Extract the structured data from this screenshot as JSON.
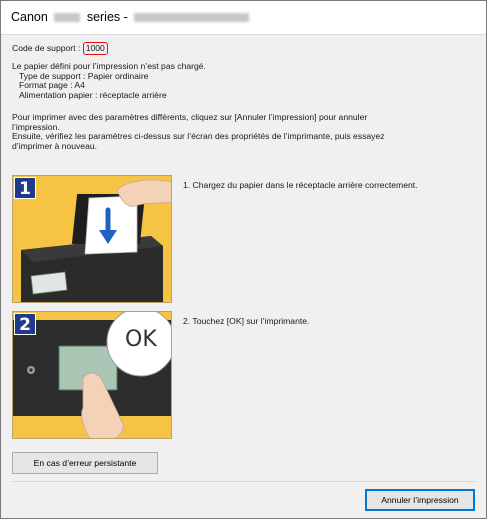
{
  "window": {
    "title_prefix": "Canon",
    "title_suffix": "series -"
  },
  "error": {
    "code_label": "Code de support :",
    "code_value": "1000"
  },
  "message": {
    "line1": "Le papier défini pour l’impression n’est pas chargé.",
    "media_type": "Type de support : Papier ordinaire",
    "page_size": "Format page : A4",
    "paper_source": "Alimentation papier : réceptacle arrière"
  },
  "instructions": {
    "line1": "Pour imprimer avec des paramètres différents, cliquez sur [Annuler l’impression] pour annuler",
    "line2": "l’impression.",
    "line3": "Ensuite, vérifiez les paramètres ci-dessus sur l’écran des propriétés de l’imprimante, puis essayez",
    "line4": "d’imprimer à nouveau."
  },
  "steps": [
    {
      "number": "1",
      "text": "1.  Chargez du papier dans le réceptacle arrière correctement."
    },
    {
      "number": "2",
      "text": "2.  Touchez [OK] sur l’imprimante.",
      "ok_label": "OK"
    }
  ],
  "buttons": {
    "persistent_error": "En cas d’erreur persistante",
    "cancel_print": "Annuler l’impression"
  },
  "colors": {
    "highlight_border": "#e01010",
    "step_panel_bg": "#f6c445",
    "step_badge": "#1f3a8a",
    "default_button_border": "#0078d7"
  }
}
